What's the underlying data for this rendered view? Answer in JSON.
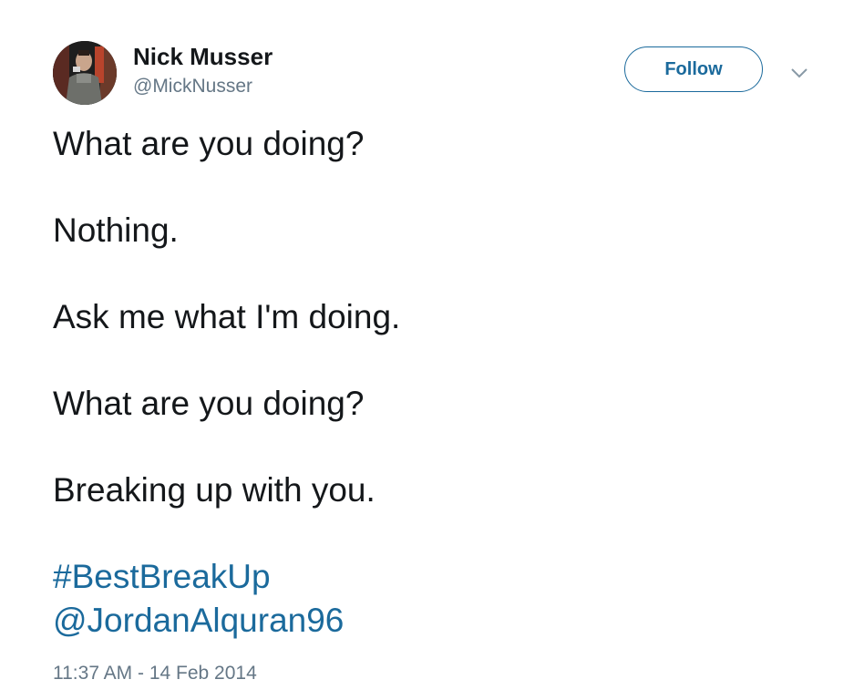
{
  "user": {
    "display_name": "Nick Musser",
    "handle": "@MickNusser"
  },
  "header": {
    "follow_label": "Follow"
  },
  "tweet": {
    "lines": [
      "What are you doing?",
      "Nothing.",
      "Ask me what I'm doing.",
      "What are you doing?",
      "Breaking up with you."
    ],
    "hashtag": "#BestBreakUp",
    "mention": "@JordanAlquran96",
    "timestamp": "11:37 AM - 14 Feb 2014"
  },
  "icons": {
    "menu": "chevron-down-icon",
    "avatar": "avatar"
  },
  "colors": {
    "link": "#1b6a9c",
    "text": "#14171a",
    "secondary": "#657786"
  }
}
